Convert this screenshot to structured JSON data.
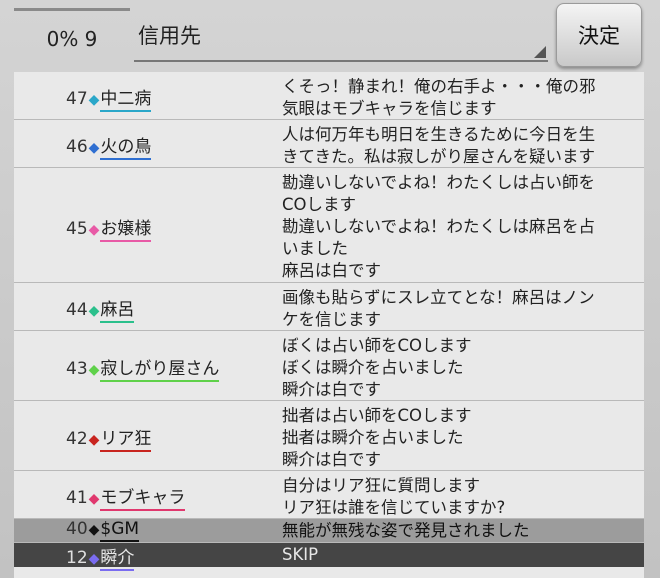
{
  "header": {
    "progress_text": "0% 9",
    "target_select": {
      "value": "信用先"
    },
    "decide_label": "決定"
  },
  "log": [
    {
      "number": "47",
      "name": "中二病",
      "color": "#2aa7c9",
      "lines": [
        "くそっ！静まれ！俺の右手よ・・・俺の邪",
        "気眼はモブキャラを信じます"
      ]
    },
    {
      "number": "46",
      "name": "火の鳥",
      "color": "#2f6fd1",
      "lines": [
        "人は何万年も明日を生きるために今日を生",
        "きてきた。私は寂しがり屋さんを疑います"
      ]
    },
    {
      "number": "45",
      "name": "お嬢様",
      "color": "#e85aa6",
      "lines": [
        "勘違いしないでよね！わたくしは占い師を",
        "COします",
        "勘違いしないでよね！わたくしは麻呂を占",
        "いました",
        "麻呂は白です"
      ]
    },
    {
      "number": "44",
      "name": "麻呂",
      "color": "#2bc08c",
      "lines": [
        "画像も貼らずにスレ立てとな！麻呂はノン",
        "ケを信じます"
      ]
    },
    {
      "number": "43",
      "name": "寂しがり屋さん",
      "color": "#5fd14a",
      "lines": [
        "ぼくは占い師をCOします",
        "ぼくは瞬介を占いました",
        "瞬介は白です"
      ]
    },
    {
      "number": "42",
      "name": "リア狂",
      "color": "#c8241f",
      "lines": [
        "拙者は占い師をCOします",
        "拙者は瞬介を占いました",
        "瞬介は白です"
      ]
    },
    {
      "number": "41",
      "name": "モブキャラ",
      "color": "#e0386e",
      "lines": [
        "自分はリア狂に質問します",
        "リア狂は誰を信じていますか?"
      ]
    },
    {
      "number": "40",
      "name": "$GM",
      "color": "#111111",
      "lines": [
        "無能が無残な姿で発見されました"
      ]
    },
    {
      "number": "12",
      "name": "瞬介",
      "color": "#7a6cf0",
      "lines": [
        "SKIP"
      ]
    }
  ]
}
